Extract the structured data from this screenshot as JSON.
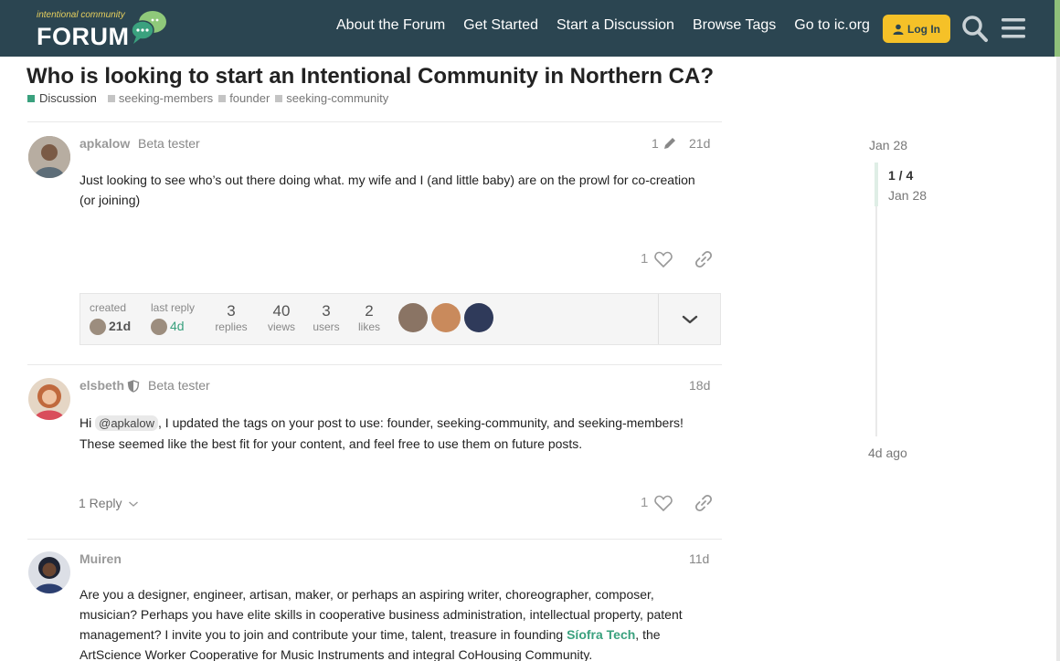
{
  "header": {
    "logo_small": "intentional community",
    "logo_big": "FORUM",
    "nav": [
      "About the Forum",
      "Get Started",
      "Start a Discussion",
      "Browse Tags",
      "Go to ic.org"
    ],
    "login_label": "Log In"
  },
  "topic": {
    "title": "Who is looking to start an Intentional Community in Northern CA?",
    "category": "Discussion",
    "tags": [
      "seeking-members",
      "founder",
      "seeking-community"
    ]
  },
  "posts": [
    {
      "username": "apkalow",
      "user_title": "Beta tester",
      "edit_count": "1",
      "date": "21d",
      "body": "Just looking to see who’s out there doing what. my wife and I (and little baby) are on the prowl for co-creation (or joining)",
      "likes": "1"
    },
    {
      "username": "elsbeth",
      "user_title": "Beta tester",
      "date": "18d",
      "mention": "@apkalow",
      "body_after_mention": ", I updated the tags on your post to use: founder, seeking-community, and seeking-members! These seemed like the best fit for your content, and feel free to use them on future posts.",
      "body_prefix": "Hi",
      "likes": "1",
      "reply_label": "1 Reply"
    },
    {
      "username": "Muiren",
      "date": "11d",
      "body_before_link": "Are you a designer, engineer, artisan, maker, or perhaps an aspiring writer, choreographer, composer, musician? Perhaps you have elite skills in cooperative business administration, intellectual property, patent management? I invite you to join and contribute your time, talent, treasure in founding ",
      "link_text": "Síofra Tech",
      "body_after_link": ", the ArtScience Worker Cooperative for Music Instruments and integral CoHousing Community."
    }
  ],
  "topic_map": {
    "created_label": "created",
    "created_value": "21d",
    "last_reply_label": "last reply",
    "last_reply_value": "4d",
    "replies_num": "3",
    "replies_label": "replies",
    "views_num": "40",
    "views_label": "views",
    "users_num": "3",
    "users_label": "users",
    "likes_num": "2",
    "likes_label": "likes"
  },
  "timeline": {
    "start_date": "Jan 28",
    "position": "1 / 4",
    "position_date": "Jan 28",
    "end_date": "4d ago"
  },
  "colors": {
    "header_bg": "#2b4551",
    "accent_green": "#3aa17e",
    "login_yellow": "#f5c128"
  }
}
